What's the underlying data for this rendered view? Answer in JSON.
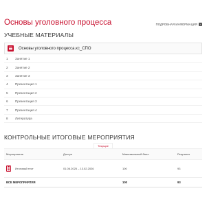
{
  "header": {
    "title": "Основы уголовного процесса",
    "more_info": "ПОДРОБНАЯ ИНФОРМАЦИЯ",
    "more_info_icon": "arrow-right-icon"
  },
  "materials": {
    "heading": "УЧЕБНЫЕ МАТЕРИАЛЫ",
    "course_name": "Основы уголовного процесса.кс_СПО",
    "course_icon": "course-book-icon",
    "items": [
      {
        "num": "1",
        "label": "Занятие 1"
      },
      {
        "num": "2",
        "label": "Занятие 2"
      },
      {
        "num": "3",
        "label": "Занятие 3"
      },
      {
        "num": "4",
        "label": "Презентация 1"
      },
      {
        "num": "5",
        "label": "Презентация 2"
      },
      {
        "num": "6",
        "label": "Презентация 3"
      },
      {
        "num": "7",
        "label": "Презентация 4"
      },
      {
        "num": "8",
        "label": "Литература"
      }
    ]
  },
  "events": {
    "heading": "КОНТРОЛЬНЫЕ ИТОГОВЫЕ МЕРОПРИЯТИЯ",
    "tab_current": "Текущие",
    "columns": [
      "Мероприятие",
      "Доступ",
      "Максимальный балл",
      "Результат"
    ],
    "rows": [
      {
        "name": "Итоговый тест",
        "access": "01.06.2025 – 13.02.2026",
        "max": "100",
        "result": "93",
        "icon": "test-clipboard-icon"
      }
    ],
    "total": {
      "label": "ВСЕ МЕРОПРИЯТИЯ",
      "max": "100",
      "result": "93"
    }
  },
  "colors": {
    "accent": "#c8102e",
    "text": "#333333",
    "border": "#eeeeee"
  }
}
